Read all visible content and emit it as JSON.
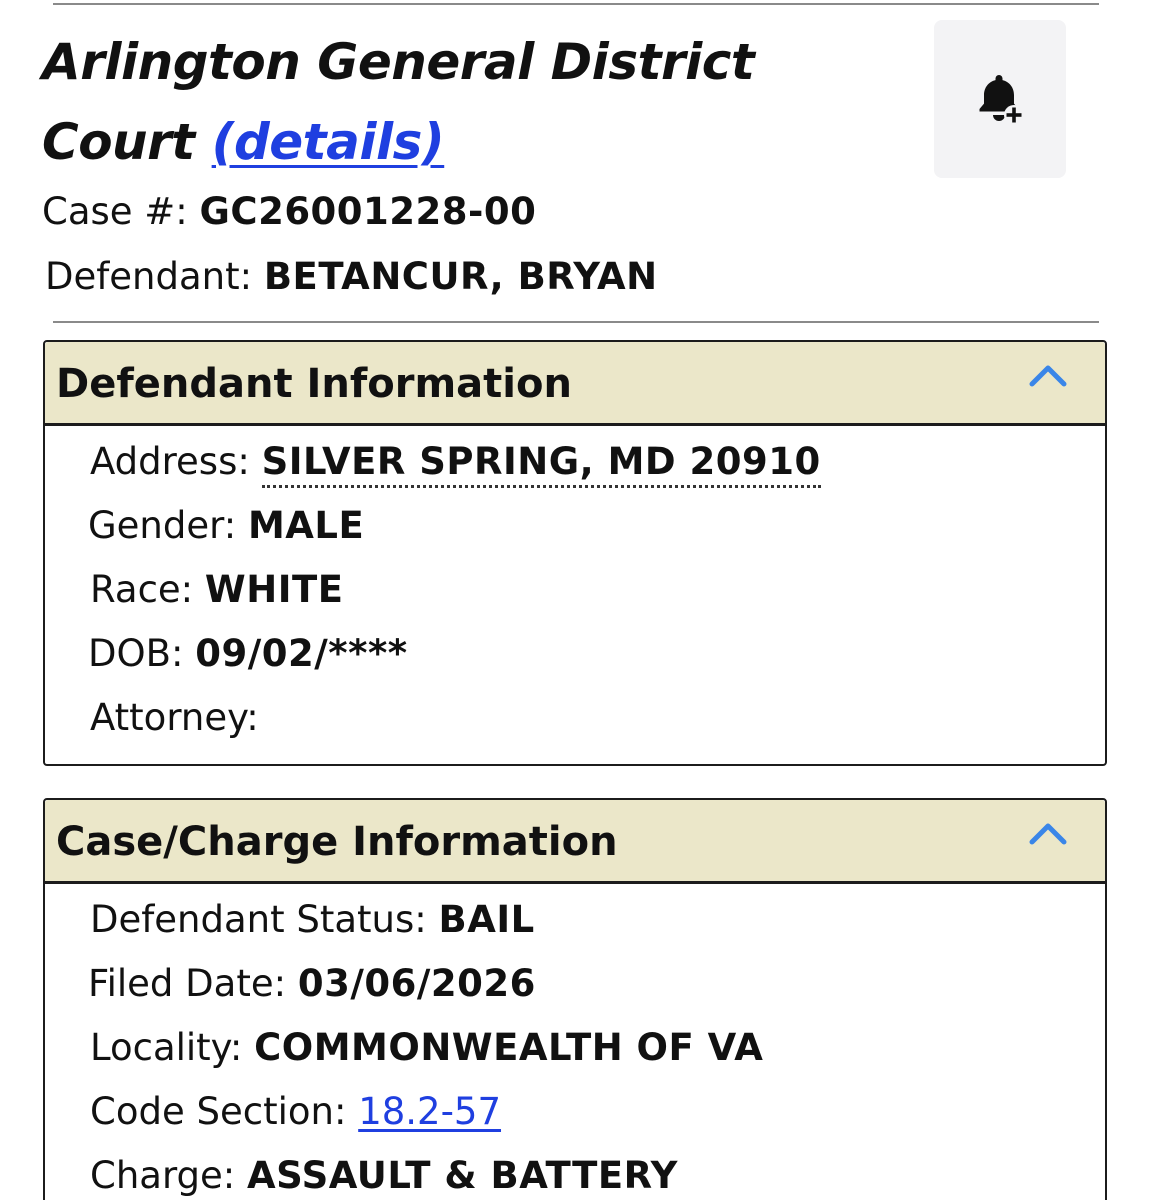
{
  "header": {
    "court_name_line1": "Arlington General District",
    "court_name_line2": "Court",
    "details_link": "(details)",
    "bell_icon": "bell-plus-icon"
  },
  "case": {
    "case_label": "Case #:",
    "case_number": "GC26001228-00",
    "defendant_label": "Defendant:",
    "defendant_name": "BETANCUR, BRYAN"
  },
  "defendant_info": {
    "title": "Defendant Information",
    "toggle_icon": "chevron-up-icon",
    "fields": [
      {
        "label": "Address:",
        "value": "SILVER SPRING, MD 20910"
      },
      {
        "label": "Gender:",
        "value": "MALE"
      },
      {
        "label": "Race:",
        "value": "WHITE"
      },
      {
        "label": "DOB:",
        "value": "09/02/****"
      },
      {
        "label": "Attorney:",
        "value": ""
      }
    ]
  },
  "charge_info": {
    "title": "Case/Charge Information",
    "toggle_icon": "chevron-up-icon",
    "fields": [
      {
        "label": "Defendant Status:",
        "value": "BAIL"
      },
      {
        "label": "Filed Date:",
        "value": "03/06/2026"
      },
      {
        "label": "Locality:",
        "value": "COMMONWEALTH OF VA"
      },
      {
        "label": "Code Section:",
        "value": "18.2-57"
      },
      {
        "label": "Charge:",
        "value": "ASSAULT & BATTERY"
      }
    ]
  },
  "colors": {
    "panel_header_bg": "#ebe7c9",
    "link": "#1f3fe0",
    "chevron": "#3a86e8"
  }
}
